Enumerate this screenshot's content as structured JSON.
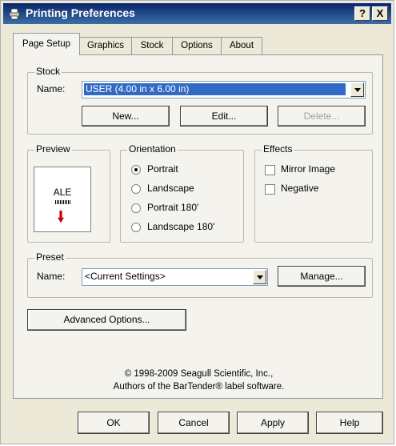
{
  "window": {
    "title": "Printing Preferences",
    "help_label": "?",
    "close_label": "X"
  },
  "tabs": [
    {
      "label": "Page Setup",
      "active": true
    },
    {
      "label": "Graphics"
    },
    {
      "label": "Stock"
    },
    {
      "label": "Options"
    },
    {
      "label": "About"
    }
  ],
  "stock": {
    "legend": "Stock",
    "name_label": "Name:",
    "name_value": "USER (4.00 in x 6.00 in)",
    "new_label": "New...",
    "edit_label": "Edit...",
    "delete_label": "Delete..."
  },
  "preview": {
    "legend": "Preview",
    "text": "ALE"
  },
  "orientation": {
    "legend": "Orientation",
    "options": [
      {
        "label": "Portrait",
        "checked": true
      },
      {
        "label": "Landscape"
      },
      {
        "label": "Portrait 180'"
      },
      {
        "label": "Landscape 180'"
      }
    ]
  },
  "effects": {
    "legend": "Effects",
    "mirror_label": "Mirror Image",
    "negative_label": "Negative"
  },
  "preset": {
    "legend": "Preset",
    "name_label": "Name:",
    "name_value": "<Current Settings>",
    "manage_label": "Manage..."
  },
  "advanced_label": "Advanced Options...",
  "copyright": {
    "line1": "© 1998-2009 Seagull Scientific, Inc.,",
    "line2": "Authors of the BarTender® label software."
  },
  "footer": {
    "ok": "OK",
    "cancel": "Cancel",
    "apply": "Apply",
    "help": "Help"
  },
  "colors": {
    "title_bar": "#0a246a",
    "selection": "#316ac5",
    "arrow": "#d00000"
  }
}
